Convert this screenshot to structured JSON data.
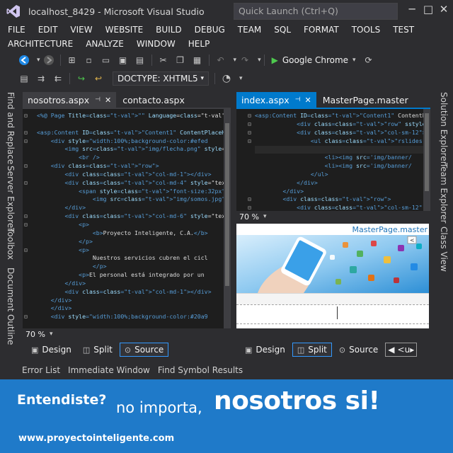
{
  "window": {
    "title": "localhost_8429 - Microsoft Visual Studio",
    "quick_launch_placeholder": "Quick Launch (Ctrl+Q)"
  },
  "menu": {
    "row1": [
      "FILE",
      "EDIT",
      "VIEW",
      "WEBSITE",
      "BUILD",
      "DEBUG",
      "TEAM",
      "SQL",
      "FORMAT",
      "TOOLS",
      "TEST"
    ],
    "row2": [
      "ARCHITECTURE",
      "ANALYZE",
      "WINDOW",
      "HELP"
    ]
  },
  "toolbar": {
    "browser": "Google Chrome",
    "doctype": "DOCTYPE: XHTML5"
  },
  "left_side_tabs": [
    "Find and Replace",
    "Server Explorer",
    "Toolbox",
    "Document Outline"
  ],
  "right_side_tabs": [
    "Solution Explorer",
    "Team Explorer",
    "Class View"
  ],
  "left_pane": {
    "tabs": [
      {
        "label": "nosotros.aspx",
        "pin": "⊣",
        "close": "✕"
      },
      {
        "label": "contacto.aspx"
      }
    ],
    "zoom": "70 %",
    "views": {
      "design": "Design",
      "split": "Split",
      "source": "Source"
    },
    "code_lines": [
      "<%@ Page Title=\"\" Language=\"VB\" MasterPageFile=\"~",
      "",
      "<asp:Content ID=\"Content1\" ContentPlaceHolderID=\"",
      "    <div style=\"width:100%;background-color:#efed",
      "        <img src=\"img/flecha.png\" style=\"width:64",
      "            <br />",
      "    <div class=\"row\">",
      "        <div class=\"col-md-1\"></div>",
      "        <div class=\"col-md-4\" style=\"text-align:c",
      "            <span style=\"font-size:32px\">¿Quienes",
      "                <img src=\"img/somos.jpg\" style=\"w",
      "        </div>",
      "        <div class=\"col-md-6\" style=\"text-align:l",
      "            <p>",
      "                <b>Proyecto Inteligente, C.A.</b>",
      "            </p>",
      "            <p>",
      "                Nuestros servicios cubren el cicl",
      "                </p>",
      "            <p>El personal está integrado por un",
      "        </div>",
      "        <div class=\"col-md-1\"></div>",
      "    </div>",
      "    </div>",
      "    <div style=\"width:100%;background-color:#20a9"
    ]
  },
  "right_pane": {
    "tabs": [
      {
        "label": "index.aspx",
        "pin": "⊣",
        "close": "✕"
      },
      {
        "label": "MasterPage.master"
      }
    ],
    "zoom": "70 %",
    "master_label": "MasterPage.master",
    "views": {
      "design": "Design",
      "split": "Split",
      "source": "Source"
    },
    "code_lines": [
      "<asp:Content ID=\"Content1\" ContentPlaceHolder",
      "            <div class=\"row\" sstyle=\"max-widt",
      "            <div class=\"col-sm-12\">",
      "                <ul class=\"rslides\" id=\"slide",
      "                    <li><img src='img/banner/",
      "                    <li><img src='img/banner/",
      "                    <li><img src='img/banner/",
      "                </ul>",
      "            </div>",
      "        </div>",
      "        <div class=\"row\">",
      "            <div class=\"col-sm-12\" style=\"bor"
    ]
  },
  "bottom_tabs": [
    "Error List",
    "Immediate Window",
    "Find Symbol Results"
  ],
  "banner": {
    "line1": "Entendiste?",
    "line2": "no importa,",
    "line3": "nosotros si!",
    "url": "www.proyectointeligente.com"
  },
  "colors": {
    "accent": "#007acc",
    "banner": "#1f7ac9",
    "editor_bg": "#1e1e1e",
    "chrome_bg": "#2d2d30"
  }
}
